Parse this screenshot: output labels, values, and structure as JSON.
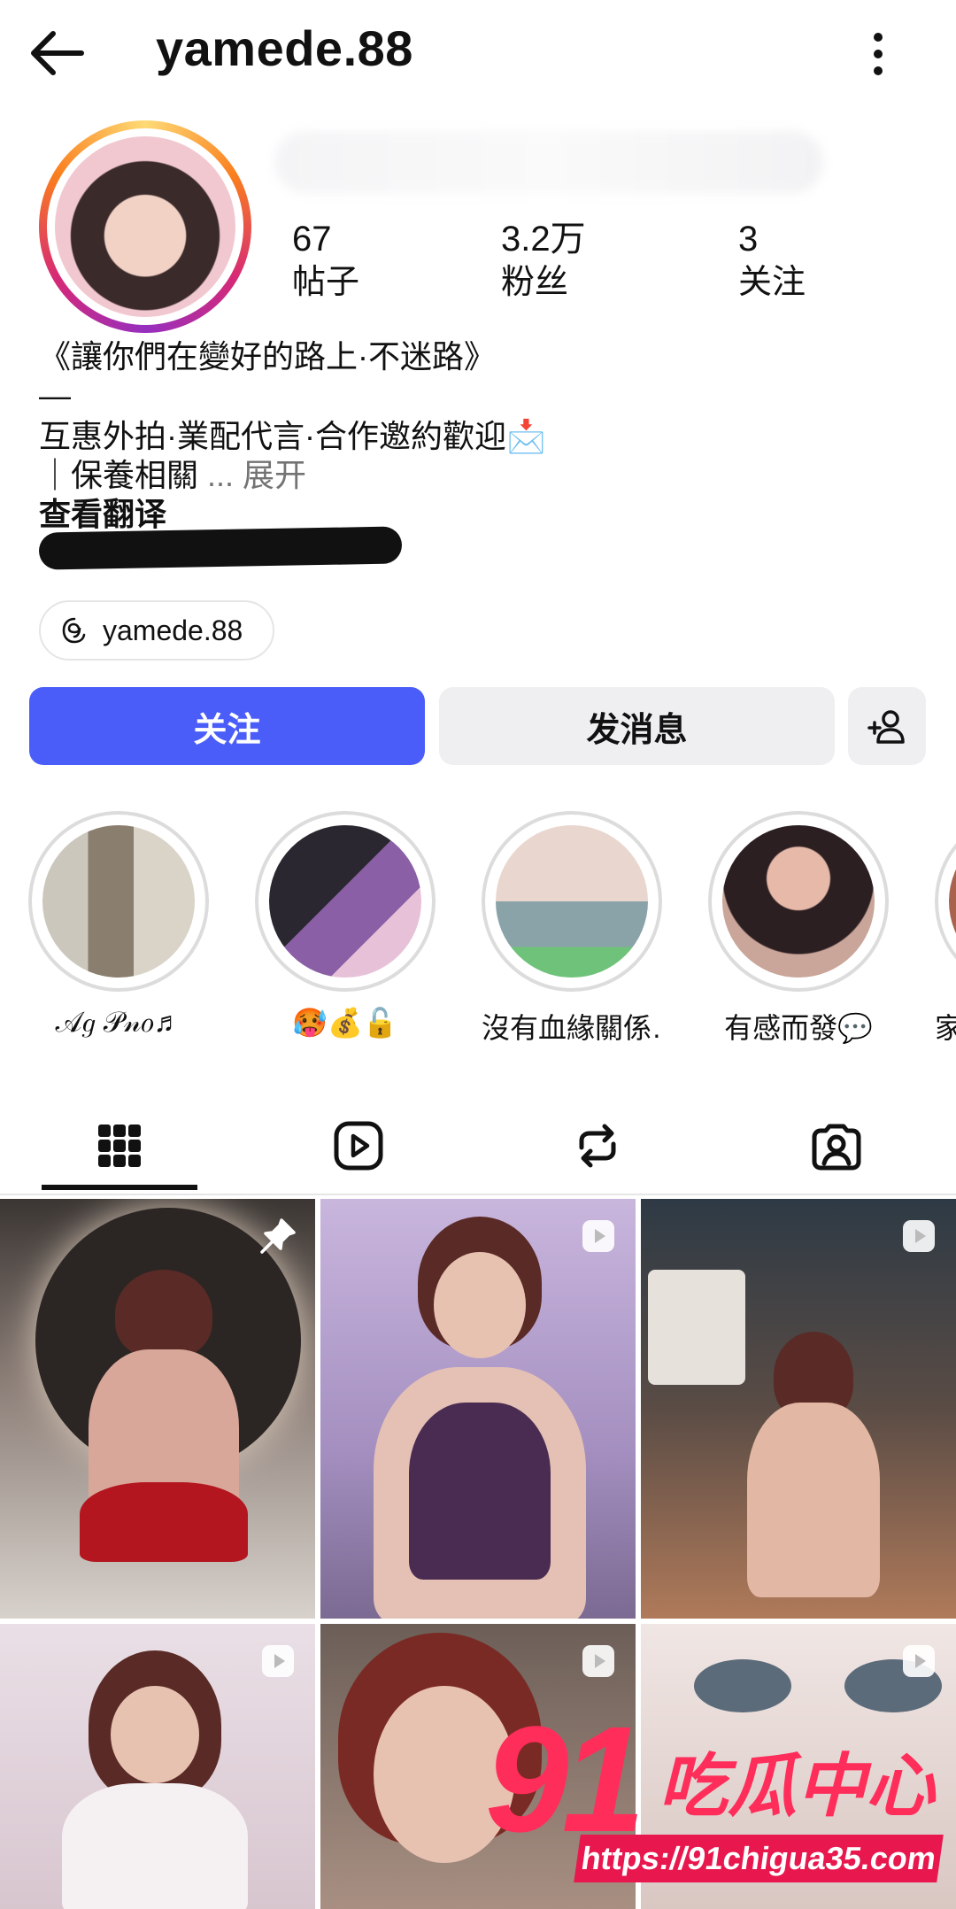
{
  "header": {
    "username": "yamede.88"
  },
  "stats": [
    {
      "value": "67",
      "label": "帖子"
    },
    {
      "value": "3.2万",
      "label": "粉丝"
    },
    {
      "value": "3",
      "label": "关注"
    }
  ],
  "bio": {
    "line1": "《讓你們在變好的路上·不迷路》",
    "line2": "—",
    "line3": "互惠外拍·業配代言·合作邀約歡迎📩",
    "line4_text": "｜保養相關",
    "more": "... 展开",
    "translate": "查看翻译"
  },
  "threads_handle": "yamede.88",
  "buttons": {
    "follow": "关注",
    "message": "发消息"
  },
  "highlights": [
    {
      "label": "𝒜𝑔 𝒫𝓃𝑜♬"
    },
    {
      "label": "🥵💰🔓"
    },
    {
      "label": "沒有血緣關係…"
    },
    {
      "label": "有感而發💬"
    },
    {
      "label": "家"
    }
  ],
  "tabs": [
    "grid-icon",
    "reels-icon",
    "reposts-icon",
    "tagged-icon"
  ],
  "watermark": {
    "number": "91",
    "text": "吃瓜中心",
    "url": "https://91chigua35.com"
  },
  "colors": {
    "accent": "#4a5df9",
    "watermark": "#ff2d5a"
  }
}
